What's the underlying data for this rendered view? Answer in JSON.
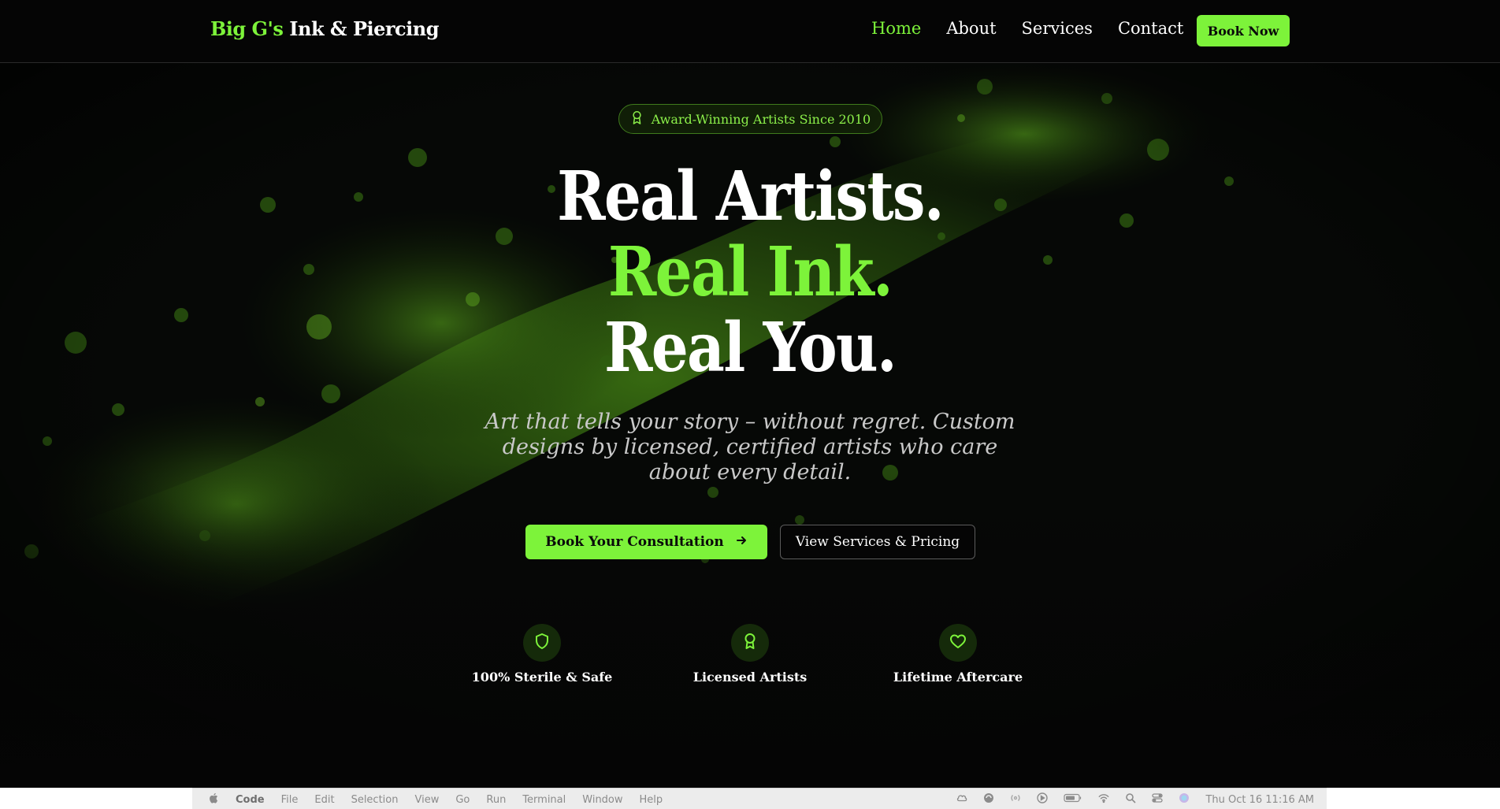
{
  "nav": {
    "brand_accent": "Big G's",
    "brand_rest": "Ink & Piercing",
    "links": [
      {
        "label": "Home",
        "active": true
      },
      {
        "label": "About",
        "active": false
      },
      {
        "label": "Services",
        "active": false
      },
      {
        "label": "Contact",
        "active": false
      }
    ],
    "cta_label": "Book Now"
  },
  "hero": {
    "badge_icon": "award-icon",
    "badge_text": "Award-Winning Artists Since 2010",
    "headline_line1": "Real Artists.",
    "headline_line2": "Real Ink.",
    "headline_line3": "Real You.",
    "subtitle": "Art that tells your story – without regret. Custom designs by licensed, certified artists who care about every detail.",
    "primary_button": "Book Your Consultation",
    "primary_button_icon": "arrow-right-icon",
    "secondary_button": "View Services & Pricing",
    "features": [
      {
        "icon": "shield-icon",
        "label": "100% Sterile & Safe"
      },
      {
        "icon": "award-icon",
        "label": "Licensed Artists"
      },
      {
        "icon": "heart-icon",
        "label": "Lifetime Aftercare"
      }
    ]
  },
  "menubar": {
    "apple_icon": "apple-icon",
    "app_name": "Code",
    "menus": [
      "File",
      "Edit",
      "Selection",
      "View",
      "Go",
      "Run",
      "Terminal",
      "Window",
      "Help"
    ],
    "status_icons": [
      "creative-cloud-icon",
      "sync-icon",
      "podcast-icon",
      "play-icon",
      "battery-icon",
      "wifi-icon",
      "search-icon",
      "control-center-icon",
      "siri-icon"
    ],
    "datetime": "Thu Oct 16  11:16 AM"
  },
  "colors": {
    "accent": "#7df33a",
    "background": "#050505",
    "text": "#ffffff",
    "muted_text": "#c9c9c9"
  }
}
